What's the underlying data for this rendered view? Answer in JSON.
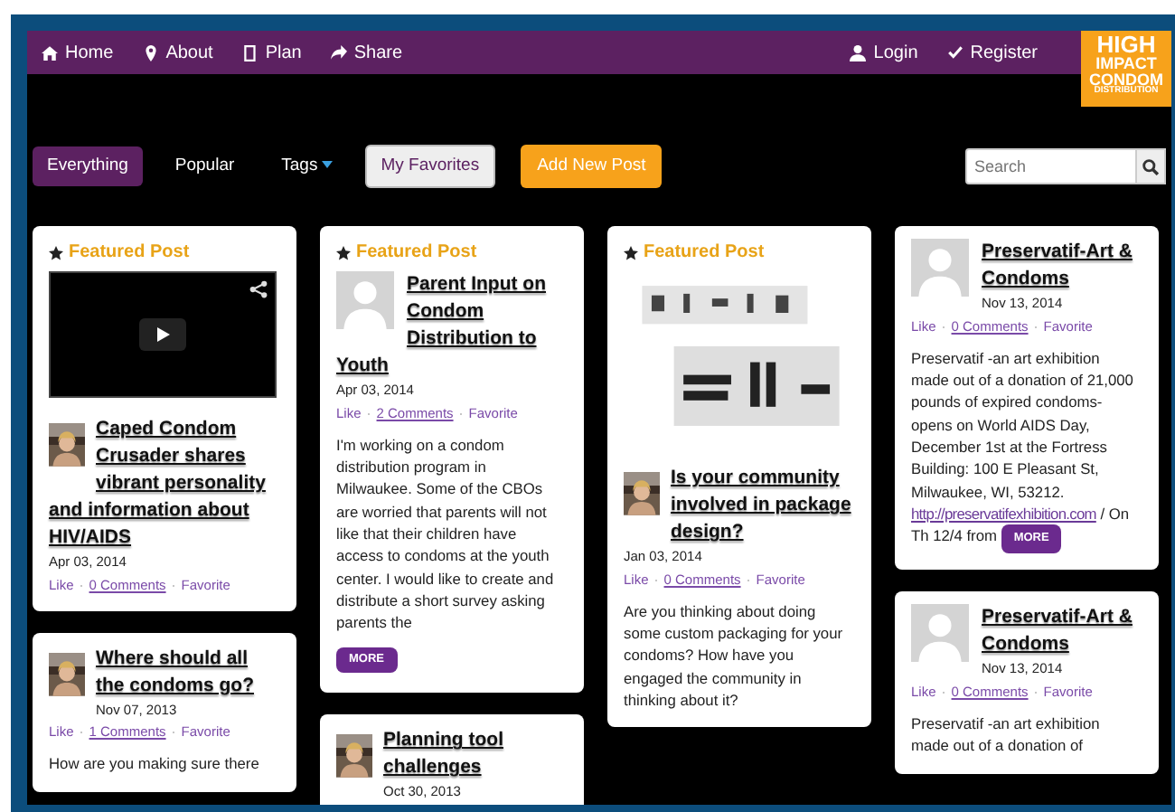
{
  "nav": {
    "left": [
      {
        "label": "Home"
      },
      {
        "label": "About"
      },
      {
        "label": "Plan"
      },
      {
        "label": "Share"
      }
    ],
    "right": [
      {
        "label": "Login"
      },
      {
        "label": "Register"
      }
    ]
  },
  "logo": {
    "lines": [
      "HIGH",
      "IMPACT",
      "CONDOM",
      "DISTRIBUTION"
    ]
  },
  "filters": [
    {
      "label": "Everything",
      "selected": true,
      "kind": "pill"
    },
    {
      "label": "Popular",
      "selected": false,
      "kind": "pill"
    },
    {
      "label": "Tags",
      "selected": false,
      "kind": "dropdown"
    },
    {
      "label": "My Favorites",
      "selected": false,
      "kind": "outline"
    }
  ],
  "add_button": "Add New Post",
  "search": {
    "placeholder": "Search"
  },
  "columns": [
    [
      {
        "featured_label": "Featured Post",
        "media": {
          "kind": "video"
        },
        "title": "Caped Condom Crusader shares vibrant personality and information about HIV/AIDS",
        "date": "Apr 03, 2014",
        "actions": [
          {
            "kind": "link",
            "label": "Like"
          },
          {
            "kind": "separator",
            "label": "·"
          },
          {
            "kind": "link",
            "label": "0 Comments"
          },
          {
            "kind": "separator",
            "label": "·"
          },
          {
            "kind": "link",
            "label": "Favorite"
          }
        ]
      },
      {
        "title": "Where should all the condoms go?",
        "date": "Nov 07, 2013",
        "actions": [
          {
            "kind": "link",
            "label": "Like"
          },
          {
            "kind": "separator",
            "label": "·"
          },
          {
            "kind": "link",
            "label": "1 Comments"
          },
          {
            "kind": "separator",
            "label": "·"
          },
          {
            "kind": "link",
            "label": "Favorite"
          }
        ],
        "text": "How are you making sure there"
      }
    ],
    [
      {
        "featured_label": "Featured Post",
        "avatar": {
          "kind": "placeholder"
        },
        "title": "Parent Input on Condom Distribution to Youth",
        "date": "Apr 03, 2014",
        "actions": [
          {
            "kind": "link",
            "label": "Like"
          },
          {
            "kind": "separator",
            "label": "·"
          },
          {
            "kind": "link",
            "label": "2 Comments"
          },
          {
            "kind": "separator",
            "label": "·"
          },
          {
            "kind": "link",
            "label": "Favorite"
          }
        ],
        "text": "I'm working on a condom distribution program in Milwaukee. Some of the CBOs are worried that parents will not like that their children have access to condoms at the youth center. I would like to create and distribute a short survey asking parents the",
        "more": "MORE"
      },
      {
        "title": "Planning tool challenges",
        "date": "Oct 30, 2013"
      }
    ],
    [
      {
        "featured_label": "Featured Post",
        "title": "Is your community involved in package design?",
        "date": "Jan 03, 2014",
        "actions": [
          {
            "kind": "link",
            "label": "Like"
          },
          {
            "kind": "separator",
            "label": "·"
          },
          {
            "kind": "link",
            "label": "0 Comments"
          },
          {
            "kind": "separator",
            "label": "·"
          },
          {
            "kind": "link",
            "label": "Favorite"
          }
        ],
        "text": "Are you thinking about doing some custom packaging for your condoms? How have you engaged the community in thinking about it?"
      }
    ],
    [
      {
        "avatar": {
          "kind": "placeholder"
        },
        "title": "Preservatif-Art & Condoms",
        "date": "Nov 13, 2014",
        "actions": [
          {
            "kind": "link",
            "label": "Like"
          },
          {
            "kind": "separator",
            "label": "·"
          },
          {
            "kind": "link",
            "label": "0 Comments"
          },
          {
            "kind": "separator",
            "label": "·"
          },
          {
            "kind": "link",
            "label": "Favorite"
          }
        ],
        "text": "Preservatif -an art exhibition made out of a donation of 21,000 pounds of expired condoms- opens on World AIDS Day, December 1st at the Fortress Building: 100 E Pleasant St, Milwaukee, WI, 53212.",
        "link": "http://preservatifexhibition.com",
        "text_after": "/ On Th 12/4 from",
        "more": "MORE"
      },
      {
        "avatar": {
          "kind": "placeholder"
        },
        "title": "Preservatif-Art & Condoms",
        "date": "Nov 13, 2014",
        "actions": [
          {
            "kind": "link",
            "label": "Like"
          },
          {
            "kind": "separator",
            "label": "·"
          },
          {
            "kind": "link",
            "label": "0 Comments"
          },
          {
            "kind": "separator",
            "label": "·"
          },
          {
            "kind": "link",
            "label": "Favorite"
          }
        ],
        "text": "Preservatif -an art exhibition made out of a donation of"
      }
    ]
  ]
}
